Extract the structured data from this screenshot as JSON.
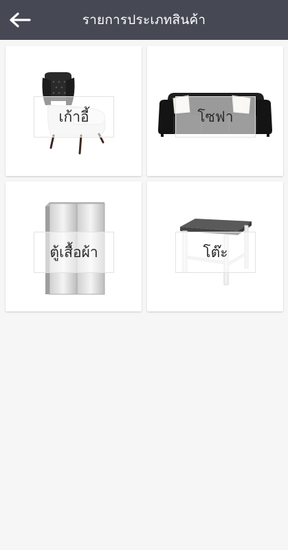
{
  "header": {
    "title": "รายการประเภทสินค้า",
    "back_icon": "arrow-left-icon"
  },
  "categories": [
    {
      "label": "เก้าอี้",
      "icon": "armchair-icon"
    },
    {
      "label": "โซฟา",
      "icon": "sofa-icon"
    },
    {
      "label": "ตู้เสื้อผ้า",
      "icon": "wardrobe-icon"
    },
    {
      "label": "โต๊ะ",
      "icon": "table-icon"
    }
  ],
  "colors": {
    "header_bg": "#464954",
    "page_bg": "#f6f6f6",
    "card_bg": "#ffffff"
  }
}
